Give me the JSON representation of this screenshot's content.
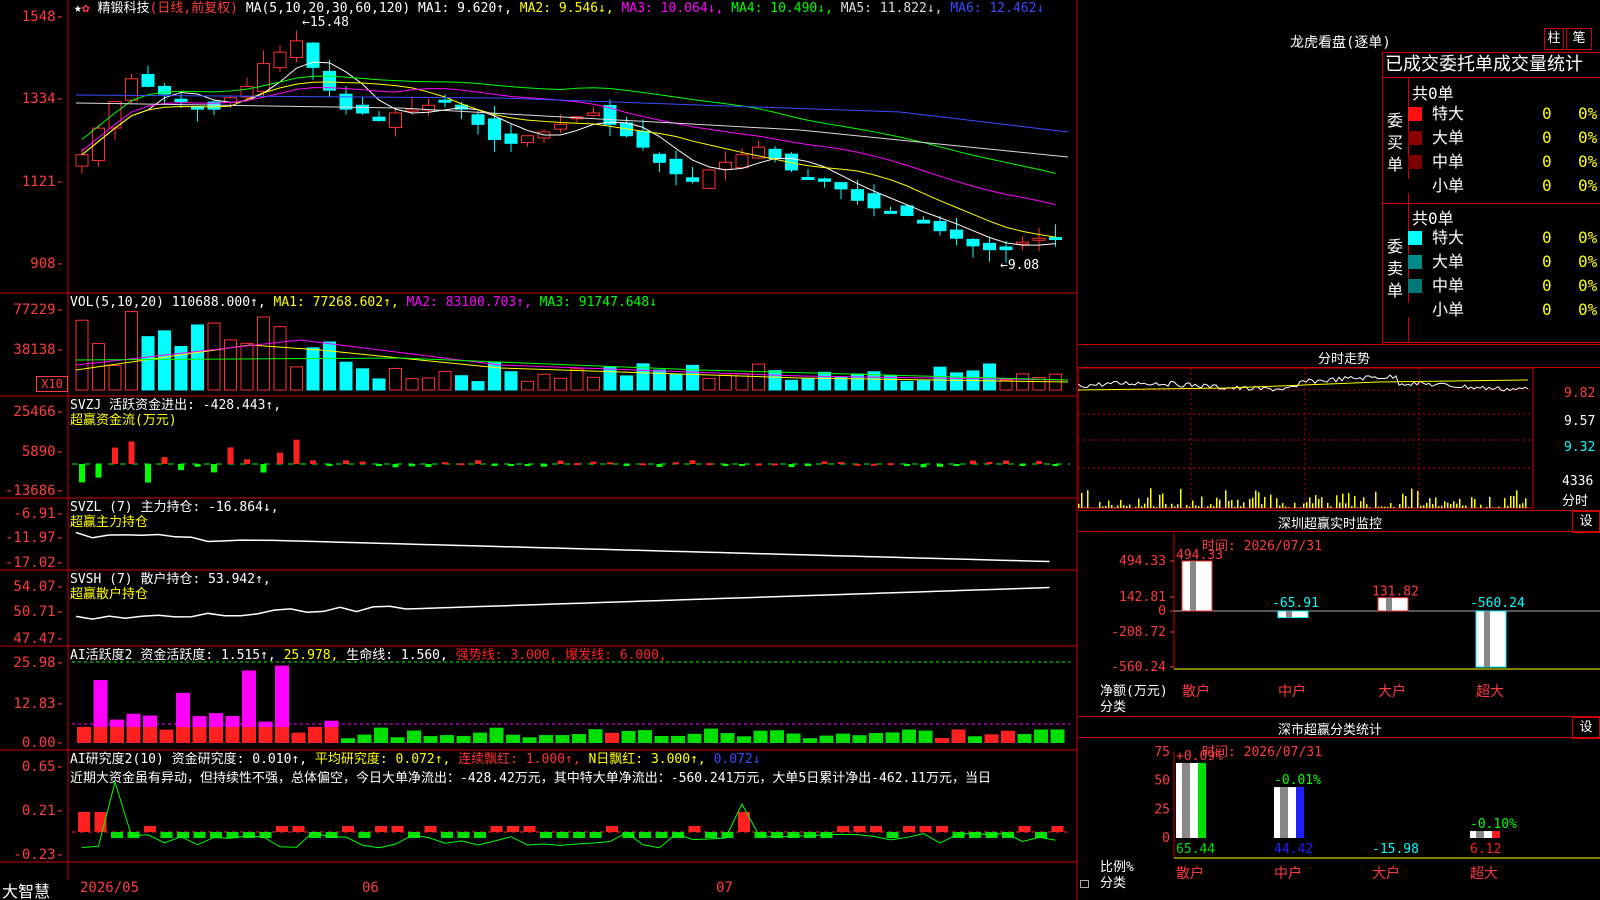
{
  "stock": {
    "name": "精锻科技",
    "mode": "(日线,前复权)",
    "ma_label": "MA(5,10,20,30,60,120)",
    "ma": [
      {
        "k": "MA1:",
        "v": "9.620↑",
        "c": "#ffffff"
      },
      {
        "k": "MA2:",
        "v": "9.546↓",
        "c": "#ffff00"
      },
      {
        "k": "MA3:",
        "v": "10.064↓",
        "c": "#ff00ff"
      },
      {
        "k": "MA4:",
        "v": "10.490↓",
        "c": "#00ff00"
      },
      {
        "k": "MA5:",
        "v": "11.822↓",
        "c": "#dcdcdc"
      },
      {
        "k": "MA6:",
        "v": "12.462↓",
        "c": "#3b4bff"
      }
    ],
    "high_note": "15.48",
    "low_note": "9.08",
    "yticks": [
      "1548",
      "1334",
      "1121",
      "908"
    ]
  },
  "vol": {
    "title": "VOL(5,10,20)",
    "val": "110688.000↑",
    "ma": [
      {
        "k": "MA1:",
        "v": "77268.602↑",
        "c": "#ffff00"
      },
      {
        "k": "MA2:",
        "v": "83100.703↑",
        "c": "#ff00ff"
      },
      {
        "k": "MA3:",
        "v": "91747.648↓",
        "c": "#00ff00"
      }
    ],
    "yticks": [
      "77229",
      "38138"
    ],
    "unit": "X10"
  },
  "svzj": {
    "title": "SVZJ",
    "label": "活跃资金进出:",
    "val": "-428.443↑,",
    "sub": "超赢资金流(万元)",
    "yticks": [
      "25466",
      "5890",
      "-13686"
    ]
  },
  "svzl": {
    "title": "SVZL (7)",
    "label": "主力持仓:",
    "val": "-16.864↓,",
    "sub": "超赢主力持仓",
    "yticks": [
      "-6.91",
      "-11.97",
      "-17.02"
    ]
  },
  "svsh": {
    "title": "SVSH (7)",
    "label": "散户持仓:",
    "val": "53.942↑,",
    "sub": "超赢散户持仓",
    "yticks": [
      "54.07",
      "50.71",
      "47.47"
    ]
  },
  "ai1": {
    "title": "AI活跃度2",
    "items": [
      {
        "t": "资金活跃度:",
        "c": "#ffffff"
      },
      {
        "t": "1.515↑,",
        "c": "#ffffff"
      },
      {
        "t": "25.978,",
        "c": "#ffff00"
      },
      {
        "t": "生命线:",
        "c": "#ffffff"
      },
      {
        "t": "1.560,",
        "c": "#ffffff"
      },
      {
        "t": "强势线:",
        "c": "#ff2222"
      },
      {
        "t": "3.000,",
        "c": "#ff2222"
      },
      {
        "t": "爆发线:",
        "c": "#ff2222"
      },
      {
        "t": "6.000,",
        "c": "#ff2222"
      }
    ],
    "yticks": [
      "25.98",
      "12.83",
      "0.00"
    ]
  },
  "ai2": {
    "title": "AI研究度2(10)",
    "items": [
      {
        "t": "资金研究度:",
        "c": "#ffffff"
      },
      {
        "t": "0.010↑,",
        "c": "#ffffff"
      },
      {
        "t": "平均研究度:",
        "c": "#ffff00"
      },
      {
        "t": "0.072↑,",
        "c": "#ffff00"
      },
      {
        "t": "连续飘红:",
        "c": "#ff3030"
      },
      {
        "t": "1.000↑,",
        "c": "#ff3030"
      },
      {
        "t": "N日飘红:",
        "c": "#ffff00"
      },
      {
        "t": "3.000↑,",
        "c": "#ffff00"
      },
      {
        "t": "0.072↓",
        "c": "#3b4bff"
      }
    ],
    "comment": "近期大资金虽有异动，但持续性不强，总体偏空，今日大单净流出：-428.42万元，其中特大单净流出：-560.241万元，大单5日累计净出-462.11万元，当日",
    "yticks": [
      "0.65",
      "0.21",
      "-0.23"
    ]
  },
  "bottom": {
    "logo": "大智慧",
    "dates": [
      "2026/05",
      "06",
      "07"
    ]
  },
  "lhb": {
    "title": "龙虎看盘(逐单)",
    "btns": [
      "柱",
      "笔"
    ],
    "header": "已成交委托单成交量统计",
    "buy_total": "共0单",
    "sell_total": "共0单",
    "buy_label": "委买单",
    "sell_label": "委卖单",
    "buy": [
      {
        "n": "特大",
        "v": "0",
        "p": "0%",
        "c": "#ff1010"
      },
      {
        "n": "大单",
        "v": "0",
        "p": "0%",
        "c": "#8b0000"
      },
      {
        "n": "中单",
        "v": "0",
        "p": "0%",
        "c": "#7a0000"
      },
      {
        "n": "小单",
        "v": "0",
        "p": "0%",
        "c": "#000000"
      }
    ],
    "sell": [
      {
        "n": "特大",
        "v": "0",
        "p": "0%",
        "c": "#00ffff"
      },
      {
        "n": "大单",
        "v": "0",
        "p": "0%",
        "c": "#008b8b"
      },
      {
        "n": "中单",
        "v": "0",
        "p": "0%",
        "c": "#007878"
      },
      {
        "n": "小单",
        "v": "0",
        "p": "0%",
        "c": "#000000"
      }
    ]
  },
  "fenshi": {
    "title": "分时走势",
    "yticks": [
      "9.82",
      "9.57",
      "9.32"
    ],
    "vol": "4336",
    "vol_unit": "分时"
  },
  "sz": {
    "title": "深圳超赢实时监控",
    "set": "设",
    "time": "时间: 2026/07/31",
    "yticks": [
      "494.33",
      "142.81",
      "0",
      "-208.72",
      "-560.24"
    ],
    "ylabel": "净额(万元)",
    "xlabel": "分类",
    "bars": [
      {
        "cat": "散户",
        "val": "494.33",
        "v": 494.33
      },
      {
        "cat": "中户",
        "val": "-65.91",
        "v": -65.91
      },
      {
        "cat": "大户",
        "val": "131.82",
        "v": 131.82
      },
      {
        "cat": "超大",
        "val": "-560.24",
        "v": -560.24
      }
    ]
  },
  "ss": {
    "title": "深市超赢分类统计",
    "set": "设",
    "time": "时间: 2026/07/31",
    "yticks": [
      "75",
      "50",
      "25",
      "0"
    ],
    "ylabel": "比例%",
    "xlabel": "分类",
    "bars": [
      {
        "cat": "散户",
        "val": "65.44",
        "chg": "+0.09%",
        "v": 65.44,
        "c": "#00e000"
      },
      {
        "cat": "中户",
        "val": "44.42",
        "chg": "-0.01%",
        "v": 44.42,
        "c": "#2020ff"
      },
      {
        "cat": "大户",
        "val": "-15.98",
        "chg": "",
        "v": 0,
        "c": "#00ffff"
      },
      {
        "cat": "超大",
        "val": "6.12",
        "chg": "-0.10%",
        "v": 6.12,
        "c": "#ff2020"
      }
    ]
  }
}
